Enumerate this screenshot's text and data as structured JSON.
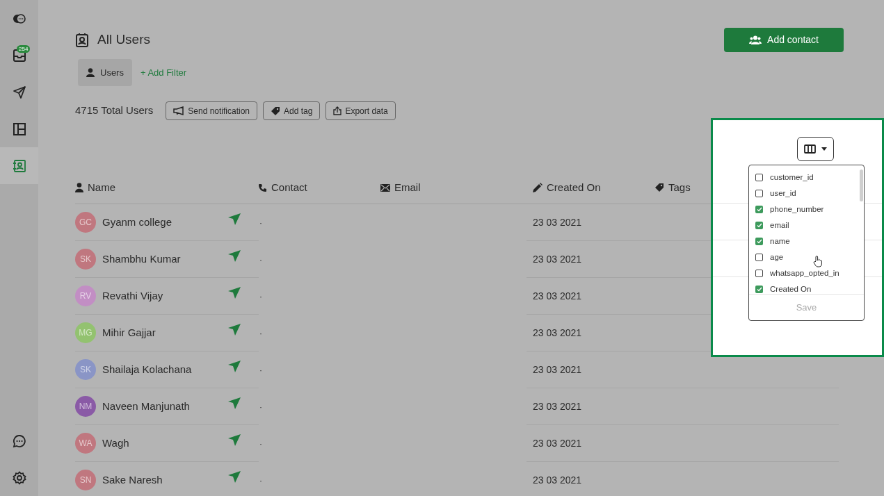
{
  "sidebar": {
    "items": [
      {
        "kind": "logo",
        "selected": false
      },
      {
        "kind": "inbox",
        "badge": "254",
        "selected": false
      },
      {
        "kind": "send",
        "selected": false
      },
      {
        "kind": "layout",
        "selected": false
      },
      {
        "kind": "contacts",
        "selected": true
      }
    ],
    "bottom_items": [
      {
        "kind": "chat",
        "selected": false
      },
      {
        "kind": "settings",
        "selected": false
      }
    ]
  },
  "page": {
    "title": "All Users",
    "add_contact": "Add contact",
    "segment": "Users",
    "add_filter": "+ Add Filter",
    "total": "4715 Total Users",
    "actions": [
      {
        "kind": "notify",
        "label": "Send notification"
      },
      {
        "kind": "tag",
        "label": "Add tag"
      },
      {
        "kind": "export",
        "label": "Export data"
      }
    ]
  },
  "table": {
    "columns": [
      {
        "kind": "name",
        "label": "Name"
      },
      {
        "kind": "contact",
        "label": "Contact"
      },
      {
        "kind": "email",
        "label": "Email"
      },
      {
        "kind": "created",
        "label": "Created On"
      },
      {
        "kind": "tags",
        "label": "Tags"
      }
    ],
    "rows": [
      {
        "initials": "GC",
        "color": "#c0777f",
        "name": "Gyanm college",
        "contact": "·",
        "created_on": "23 03 2021"
      },
      {
        "initials": "SK",
        "color": "#c0777f",
        "name": "Shambhu Kumar",
        "contact": "·",
        "created_on": "23 03 2021"
      },
      {
        "initials": "RV",
        "color": "#c28ec4",
        "name": "Revathi Vijay",
        "contact": "·",
        "created_on": "23 03 2021"
      },
      {
        "initials": "MG",
        "color": "#93c270",
        "name": "Mihir Gajjar",
        "contact": "·",
        "created_on": "23 03 2021"
      },
      {
        "initials": "SK",
        "color": "#8a95c6",
        "name": "Shailaja Kolachana",
        "contact": "·",
        "created_on": "23 03 2021"
      },
      {
        "initials": "NM",
        "color": "#8a5aa6",
        "name": "Naveen Manjunath",
        "contact": "·",
        "created_on": "23 03 2021"
      },
      {
        "initials": "WA",
        "color": "#c0777f",
        "name": "Wagh",
        "contact": "·",
        "created_on": "23 03 2021"
      },
      {
        "initials": "SN",
        "color": "#c0777f",
        "name": "Sake Naresh",
        "contact": "·",
        "created_on": "23 03 2021"
      }
    ]
  },
  "column_picker": {
    "options": [
      {
        "label": "customer_id",
        "checked": false
      },
      {
        "label": "user_id",
        "checked": false
      },
      {
        "label": "phone_number",
        "checked": true
      },
      {
        "label": "email",
        "checked": true
      },
      {
        "label": "name",
        "checked": true
      },
      {
        "label": "age",
        "checked": false
      },
      {
        "label": "whatsapp_opted_in",
        "checked": false
      },
      {
        "label": "Created On",
        "checked": true
      }
    ],
    "save": "Save"
  }
}
